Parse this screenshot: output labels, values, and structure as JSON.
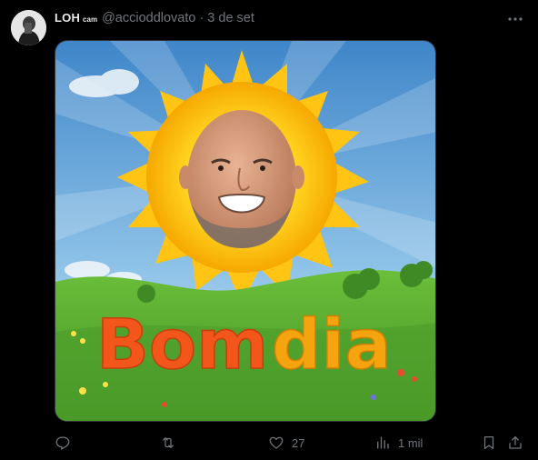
{
  "author": {
    "display_name": "LOH",
    "display_superscript": "cam",
    "handle": "@accioddlovato",
    "separator": "·",
    "timestamp": "3 de set",
    "avatar_icon": "avatar-photo-icon"
  },
  "post": {
    "media_text": "Bom dia",
    "media_text_colors": [
      "#f2561a",
      "#f5a30e"
    ]
  },
  "actions": {
    "reply": {
      "icon": "reply-icon",
      "count": ""
    },
    "repost": {
      "icon": "repost-icon",
      "count": ""
    },
    "like": {
      "icon": "heart-icon",
      "count": "27"
    },
    "views": {
      "icon": "views-icon",
      "count": "1 mil"
    },
    "bookmark": {
      "icon": "bookmark-icon"
    },
    "share": {
      "icon": "share-icon"
    }
  },
  "more_menu": {
    "icon": "more-icon"
  },
  "colors": {
    "background": "#000000",
    "text_primary": "#e7e9ea",
    "text_secondary": "#71767b",
    "sun": "#ffd21f"
  }
}
